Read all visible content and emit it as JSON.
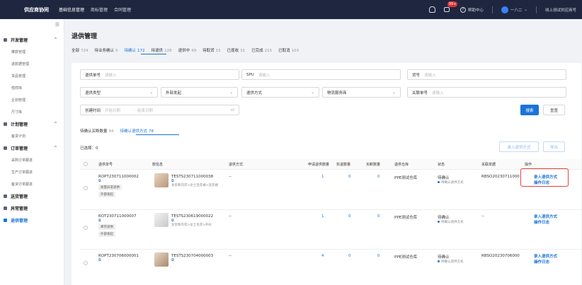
{
  "topbar": {
    "logo": "供应商协同",
    "nav": [
      "基础信息管理",
      "商标管理",
      "合同管理"
    ],
    "badge": "99+",
    "help": "帮助中心",
    "user": "一八二",
    "store": "线上测试供应商号"
  },
  "sidebar": {
    "groups": [
      {
        "label": "开发管理",
        "items": [
          "推款管理",
          "退款据管理",
          "货品管理",
          "借样库",
          "企划管理",
          "尺寸库"
        ]
      },
      {
        "label": "计划管理",
        "items": [
          "备货计划"
        ]
      },
      {
        "label": "订单管理",
        "items": [
          "采购订单跟进",
          "生产订单跟进",
          "备货订单跟进"
        ]
      },
      {
        "label": "送货管理",
        "items": []
      },
      {
        "label": "异常管理",
        "items": []
      },
      {
        "label": "退供管理",
        "items": []
      }
    ]
  },
  "page": {
    "title": "退供管理",
    "status_tabs": [
      {
        "label": "全部",
        "count": "724"
      },
      {
        "label": "待业务确认",
        "count": "0"
      },
      {
        "label": "待确认",
        "count": "172"
      },
      {
        "label": "待退供",
        "count": "128"
      },
      {
        "label": "退供中",
        "count": "49"
      },
      {
        "label": "待取货",
        "count": "15"
      },
      {
        "label": "已揽收",
        "count": "31"
      },
      {
        "label": "已完成",
        "count": "215"
      },
      {
        "label": "已取消",
        "count": "103"
      }
    ]
  },
  "filters": {
    "return_no": {
      "label": "退供单号",
      "placeholder": "请输入"
    },
    "spu": {
      "label": "SPU",
      "placeholder": "请输入"
    },
    "sku": {
      "label": "货号",
      "placeholder": "请输入"
    },
    "return_type": {
      "label": "退供类型"
    },
    "external": {
      "label": "外部发起"
    },
    "method": {
      "label": "退供方式"
    },
    "logistics": {
      "label": "物流服务商"
    },
    "related_no": {
      "label": "关联单号",
      "placeholder": "请输入"
    },
    "created": {
      "label": "创建时间",
      "start": "开始日期",
      "to": "-",
      "end": "结束日期"
    },
    "search_btn": "搜索",
    "reset_btn": "重置"
  },
  "subtabs": [
    {
      "label": "待确认买断数量",
      "count": "94"
    },
    {
      "label": "待确认退供方式",
      "count": "78"
    }
  ],
  "selected": "已选择：0",
  "actions": {
    "confirm": "录入退供方式",
    "export": "导出"
  },
  "table": {
    "headers": [
      "退供单号",
      "款信息",
      "退供方式",
      "申请退供数量",
      "实退数量",
      "买断数量",
      "退供仓库",
      "状态",
      "关联单据",
      "操作"
    ],
    "rows": [
      {
        "no": "ROPT230711000002",
        "tags": [
          "质量异常退供",
          "外部发起"
        ],
        "sku": "TESTS230711000038",
        "desc": "女装和内衣>女士连衣裙>连衣裙",
        "method": "--",
        "qty": "1",
        "real": "0",
        "buyout": "0",
        "warehouse": "PPE测试仓库",
        "status": "待确认",
        "sub": "待确认退供方式",
        "related": "RBSO20230711000",
        "op1": "录入退供方式",
        "op2": "操作日志"
      },
      {
        "no": "ROT230711000007",
        "tags": [
          "库存退供",
          "外部发起"
        ],
        "sku": "TESTS230619000022",
        "desc": "女装和内衣>女士毛衣>开衫",
        "method": "--",
        "qty": "1",
        "real": "0",
        "buyout": "0",
        "warehouse": "PPE测试仓库",
        "status": "待确认",
        "sub": "待确认退供方式",
        "related": "--",
        "op1": "录入退供方式",
        "op2": "操作日志"
      },
      {
        "no": "ROPT230706000001",
        "tags": [],
        "sku": "TESTS230704000003",
        "desc": "",
        "method": "--",
        "qty": "4",
        "real": "0",
        "buyout": "0",
        "warehouse": "PPE测试仓库",
        "status": "待确认",
        "sub": "待确认退供方式",
        "related": "RBSO20230706000",
        "op1": "录入退供方式",
        "op2": "操作日志"
      }
    ]
  },
  "colors": {
    "accent": "#1a73d9",
    "topbar": "#1f2740",
    "highlight": "#e0453a"
  }
}
